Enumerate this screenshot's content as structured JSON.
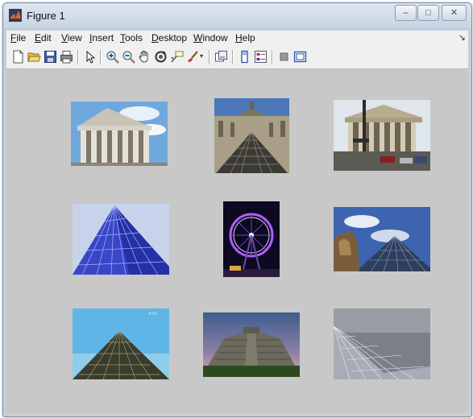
{
  "window": {
    "title": "Figure 1",
    "controls": {
      "minimize": "–",
      "maximize": "□",
      "close": "✕"
    }
  },
  "menubar": {
    "items": [
      {
        "id": "file",
        "key": "F",
        "rest": "ile"
      },
      {
        "id": "edit",
        "key": "E",
        "rest": "dit"
      },
      {
        "id": "view",
        "key": "V",
        "rest": "iew"
      },
      {
        "id": "insert",
        "key": "I",
        "rest": "nsert"
      },
      {
        "id": "tools",
        "key": "T",
        "rest": "ools"
      },
      {
        "id": "desktop",
        "key": "D",
        "rest": "esktop"
      },
      {
        "id": "window",
        "key": "W",
        "rest": "indow"
      },
      {
        "id": "help",
        "key": "H",
        "rest": "elp"
      }
    ],
    "overflow_arrow": "↘"
  },
  "toolbar": {
    "icons": [
      "new-figure-icon",
      "open-file-icon",
      "save-figure-icon",
      "print-figure-icon",
      "edit-plot-arrow-icon",
      "zoom-in-icon",
      "zoom-out-icon",
      "pan-hand-icon",
      "rotate-3d-icon",
      "data-cursor-icon",
      "brush-icon",
      "link-plot-icon",
      "insert-colorbar-icon",
      "insert-legend-icon",
      "hide-plot-tools-icon",
      "show-plot-tools-icon"
    ]
  },
  "colors": {
    "titlebar": "#d4deeb",
    "canvas": "#c8c8c8",
    "menubar": "#f0f0f0"
  },
  "images": [
    {
      "name": "madeleine-church-image",
      "subject": "neoclassical church facade with columns"
    },
    {
      "name": "louvre-pyramid-courtyard-image",
      "subject": "glass pyramid in front of palace"
    },
    {
      "name": "pantheon-street-image",
      "subject": "columned building with street"
    },
    {
      "name": "blue-glass-pyramid-image",
      "subject": "blue-lit glass pyramid"
    },
    {
      "name": "ferris-wheel-night-image",
      "subject": "illuminated ferris wheel at night"
    },
    {
      "name": "pyramid-statue-sky-image",
      "subject": "glass pyramid with statue and clouds"
    },
    {
      "name": "pyramid-blue-sky-image",
      "subject": "glass pyramid against blue sky"
    },
    {
      "name": "chichen-itza-image",
      "subject": "stepped stone pyramid at dusk"
    },
    {
      "name": "grey-glass-pyramid-image",
      "subject": "glass pyramid under grey sky"
    }
  ]
}
